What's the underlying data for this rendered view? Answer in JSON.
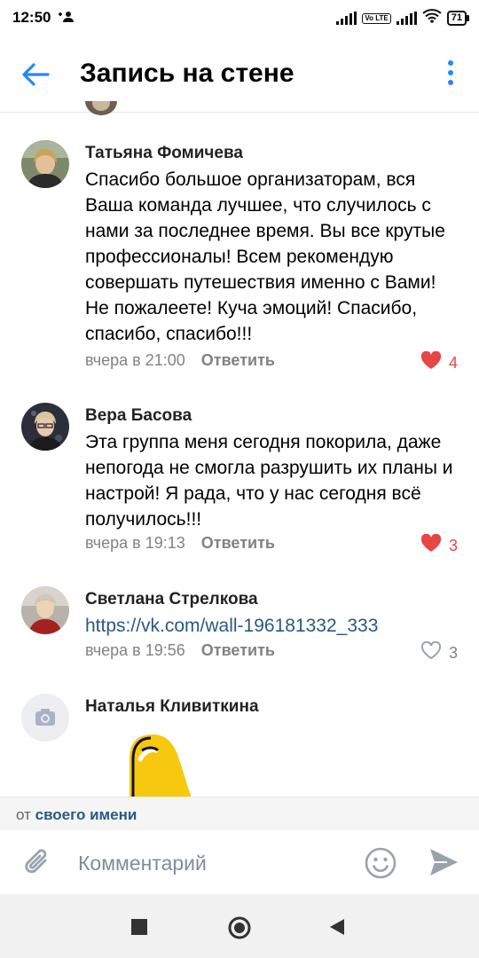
{
  "status": {
    "time": "12:50",
    "volte": "Vo LTE",
    "battery": "71"
  },
  "header": {
    "title": "Запись на стене"
  },
  "comments": [
    {
      "author": "Татьяна Фомичева",
      "text": "Спасибо большое организаторам, вся Ваша команда лучшее, что случилось с нами за последнее время. Вы все крутые профессионалы! Всем рекомендую совершать путешествия именно с Вами! Не пожалеете! Куча эмоций! Спасибо, спасибо, спасибо!!!",
      "time": "вчера в 21:00",
      "reply": "Ответить",
      "likes": "4",
      "liked": true
    },
    {
      "author": "Вера Басова",
      "text": "Эта группа меня сегодня покорила, даже непогода не смогла разрушить их планы и настрой! Я рада, что у нас сегодня всё получилось!!!",
      "time": "вчера в 19:13",
      "reply": "Ответить",
      "likes": "3",
      "liked": true
    },
    {
      "author": "Светлана Стрелкова",
      "link": "https://vk.com/wall-196181332_333",
      "time": "вчера в 19:56",
      "reply": "Ответить",
      "likes": "3",
      "liked": false
    },
    {
      "author": "Наталья Кливиткина"
    }
  ],
  "frombar": {
    "prefix": "от",
    "owner": "своего имени"
  },
  "composer": {
    "placeholder": "Комментарий"
  },
  "colors": {
    "accent": "#2787f5",
    "link": "#2a5885",
    "like": "#e64646",
    "muted": "#828282"
  }
}
